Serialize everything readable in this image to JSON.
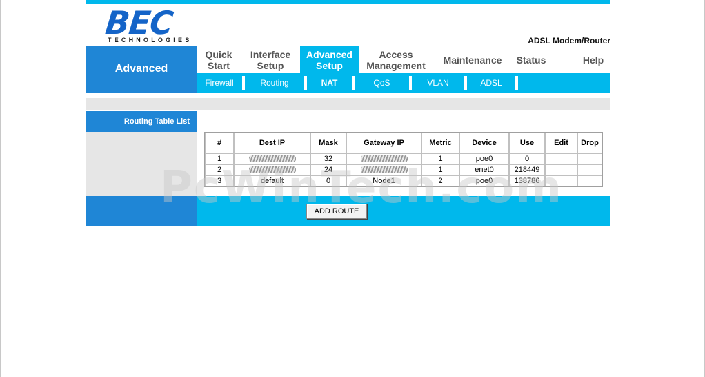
{
  "brand": {
    "logo_text": "BEC",
    "logo_sub": "TECHNOLOGIES",
    "product": "ADSL Modem/Router"
  },
  "nav": {
    "section_label": "Advanced",
    "menu": [
      {
        "line1": "Quick",
        "line2": "Start"
      },
      {
        "line1": "Interface",
        "line2": "Setup"
      },
      {
        "line1": "Advanced",
        "line2": "Setup"
      },
      {
        "line1": "Access",
        "line2": "Management"
      },
      {
        "line1": "Maintenance",
        "line2": ""
      },
      {
        "line1": "Status",
        "line2": ""
      },
      {
        "line1": "Help",
        "line2": ""
      }
    ],
    "submenu": [
      "Firewall",
      "Routing",
      "NAT",
      "QoS",
      "VLAN",
      "ADSL"
    ]
  },
  "page": {
    "side_label": "Routing Table List",
    "add_button": "ADD ROUTE",
    "watermark": "PcWinTech.com"
  },
  "table": {
    "headers": [
      "#",
      "Dest IP",
      "Mask",
      "Gateway IP",
      "Metric",
      "Device",
      "Use",
      "Edit",
      "Drop"
    ],
    "rows": [
      {
        "num": "1",
        "dest": "",
        "mask": "32",
        "gateway": "",
        "metric": "1",
        "device": "poe0",
        "use": "0"
      },
      {
        "num": "2",
        "dest": "",
        "mask": "24",
        "gateway": "",
        "metric": "1",
        "device": "enet0",
        "use": "218449"
      },
      {
        "num": "3",
        "dest": "default",
        "mask": "0",
        "gateway": "Node1",
        "metric": "2",
        "device": "poe0",
        "use": "138786"
      }
    ]
  },
  "colors": {
    "accent": "#00b8ec",
    "brand_blue": "#1f86d6",
    "logo_blue": "#1464c8"
  }
}
